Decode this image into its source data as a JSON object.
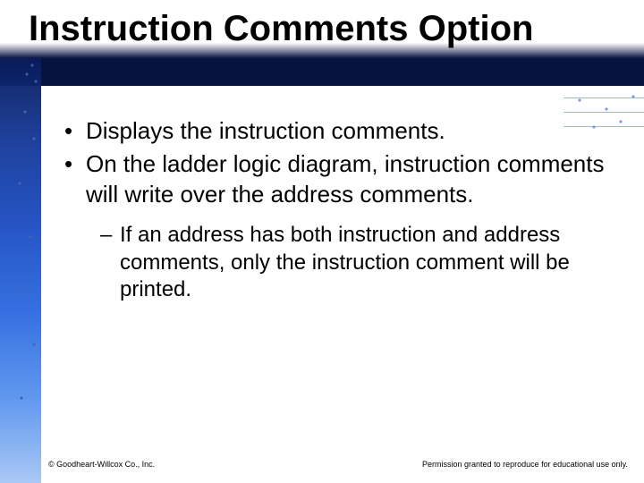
{
  "title": "Instruction Comments Option",
  "bullets": {
    "level1": [
      "Displays the instruction comments.",
      "On the ladder logic diagram, instruction comments will write over the address comments."
    ],
    "level2": [
      "If an address has both instruction and address comments, only the instruction comment will be printed."
    ]
  },
  "footer": {
    "left": "© Goodheart-Willcox Co., Inc.",
    "right": "Permission granted to reproduce for educational use only."
  }
}
